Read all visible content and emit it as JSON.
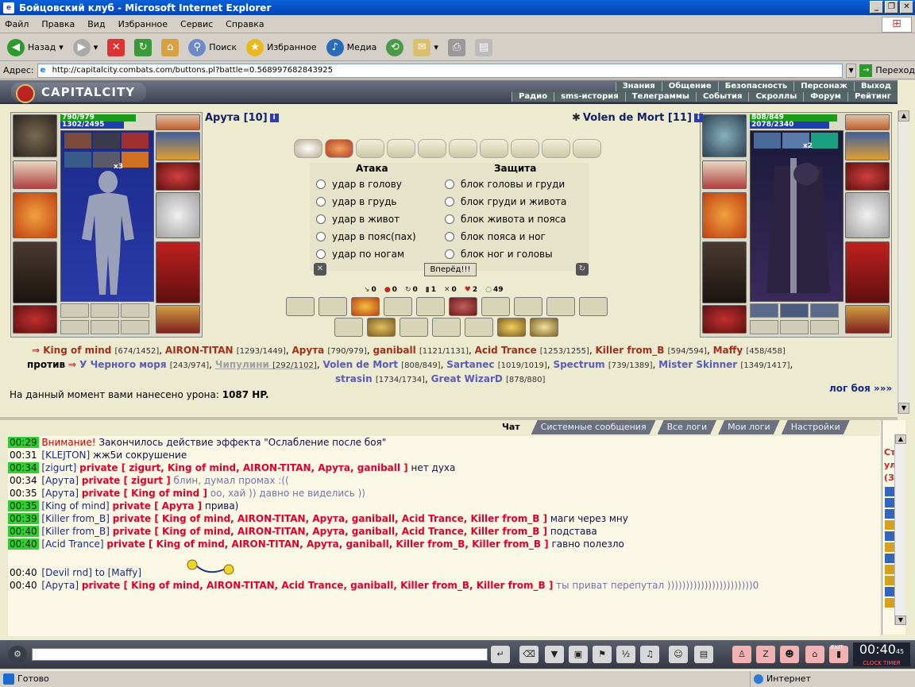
{
  "window": {
    "title": "Бойцовский клуб - Microsoft Internet Explorer"
  },
  "menu": [
    "Файл",
    "Правка",
    "Вид",
    "Избранное",
    "Сервис",
    "Справка"
  ],
  "toolbar": {
    "back": "Назад",
    "search": "Поиск",
    "favorites": "Избранное",
    "media": "Медиа"
  },
  "address": {
    "label": "Адрес:",
    "url": "http://capitalcity.combats.com/buttons.pl?battle=0.568997682843925",
    "go": "Переход"
  },
  "game": {
    "logo": "CAPITALCITY",
    "nav_top": [
      "Знания",
      "Общение",
      "Безопасность",
      "Персонаж",
      "Выход"
    ],
    "nav_bottom": [
      "Радио",
      "sms-история",
      "Телеграммы",
      "События",
      "Скроллы",
      "Форум",
      "Рейтинг"
    ]
  },
  "player_left": {
    "name": "Арута [10]",
    "hp": "790/979",
    "mana": "1302/2495",
    "stack": "x3"
  },
  "player_right": {
    "name": "Volen de Mort [11]",
    "hp": "808/849",
    "mana": "2078/2340",
    "stack": "x2"
  },
  "attack": {
    "attack_title": "Атака",
    "defense_title": "Защита",
    "attacks": [
      "удар в голову",
      "удар в грудь",
      "удар в живот",
      "удар в пояс(пах)",
      "удар по ногам"
    ],
    "defenses": [
      "блок головы и груди",
      "блок груди и живота",
      "блок живота и пояса",
      "блок пояса и ног",
      "блок ног и головы"
    ],
    "forward": "Вперёд!!!"
  },
  "stats": [
    "0",
    "0",
    "0",
    "1",
    "0",
    "2",
    "49"
  ],
  "teams": {
    "line1": [
      {
        "n": "King of mind",
        "hp": "[674/1452]"
      },
      {
        "n": "AIRON-TITAN",
        "hp": "[1293/1449]"
      },
      {
        "n": "Арута",
        "hp": "[790/979]"
      },
      {
        "n": "ganiball",
        "hp": "[1121/1131]"
      },
      {
        "n": "Acid Trance",
        "hp": "[1253/1255]"
      },
      {
        "n": "Killer from_B",
        "hp": "[594/594]"
      },
      {
        "n": "Maffy",
        "hp": "[458/458]"
      }
    ],
    "versus": "против",
    "line2": [
      {
        "n": "У Черного моря",
        "hp": "[243/974]"
      },
      {
        "n": "Чипулини",
        "hp": "[292/1102]"
      },
      {
        "n": "Volen de Mort",
        "hp": "[808/849]"
      },
      {
        "n": "Sartanec",
        "hp": "[1019/1019]"
      },
      {
        "n": "Spectrum",
        "hp": "[739/1389]"
      },
      {
        "n": "Mister Skinner",
        "hp": "[1349/1417]"
      }
    ],
    "line3": [
      {
        "n": "strasin",
        "hp": "[1734/1734]"
      },
      {
        "n": "Great WizarD",
        "hp": "[878/880]"
      }
    ]
  },
  "damage": {
    "text": "На данный момент вами нанесено урона:",
    "value": "1087 HP."
  },
  "battle_log": "лог боя »»»",
  "chat_tabs": [
    "Чат",
    "Системные сообщения",
    "Все логи",
    "Мои логи",
    "Настройки"
  ],
  "chat": [
    {
      "t": "00:29",
      "g": true,
      "pre": "Внимание!",
      "who": "",
      "priv": "",
      "msg": "Закончилось действие эффекта \"Ослабление после боя\""
    },
    {
      "t": "00:31",
      "g": false,
      "pre": "",
      "who": "[KLEJTON]",
      "priv": "",
      "msg": "жж5и сокрушение"
    },
    {
      "t": "00:34",
      "g": true,
      "pre": "",
      "who": "[zigurt]",
      "priv": "private [ zigurt, King of mind, AIRON-TITAN, Арута, ganiball ]",
      "msg": "нет духа"
    },
    {
      "t": "00:34",
      "g": false,
      "pre": "",
      "who": "[Арута]",
      "priv": "private [ zigurt ]",
      "msg": "блин, думал промах :(("
    },
    {
      "t": "00:35",
      "g": false,
      "pre": "",
      "who": "[Арута]",
      "priv": "private [ King of mind ]",
      "msg": "оо, хай )) давно не виделись ))"
    },
    {
      "t": "00:35",
      "g": true,
      "pre": "",
      "who": "[King of mind]",
      "priv": "private [ Арута ]",
      "msg": "прива)"
    },
    {
      "t": "00:39",
      "g": true,
      "pre": "",
      "who": "[Killer from_B]",
      "priv": "private [ King of mind, AIRON-TITAN, Арута, ganiball, Acid Trance, Killer from_B ]",
      "msg": "маги через мну"
    },
    {
      "t": "00:40",
      "g": true,
      "pre": "",
      "who": "[Killer from_B]",
      "priv": "private [ King of mind, AIRON-TITAN, Арута, ganiball, Acid Trance, Killer from_B ]",
      "msg": "подстава"
    },
    {
      "t": "00:40",
      "g": true,
      "pre": "",
      "who": "[Acid Trance]",
      "priv": "private [ King of mind, AIRON-TITAN, Арута, ganiball, Killer from_B, Killer from_B ]",
      "msg": "гавно полезло"
    },
    {
      "t": "",
      "g": false,
      "pre": "",
      "who": "",
      "priv": "",
      "msg": ""
    },
    {
      "t": "00:40",
      "g": false,
      "pre": "",
      "who": "[Devil rnd]",
      "priv": "",
      "msg": "to [Maffy]"
    },
    {
      "t": "00:40",
      "g": false,
      "pre": "",
      "who": "[Арута]",
      "priv": "private [ King of mind, AIRON-TITAN, Acid Trance, ganiball, Killer from_B, Killer from_B ]",
      "msg": "ты приват перепутал )))))))))))))))))))))))0"
    }
  ],
  "right_side_lines": [
    "Ст",
    "ул",
    "(З"
  ],
  "clock": {
    "time": "00:40",
    "sec": "45",
    "clock_label": "CLOCK",
    "timer_label": "TIMER"
  },
  "bottom_exit": "EXIT",
  "status": {
    "left": "Готово",
    "zone": "Интернет"
  }
}
